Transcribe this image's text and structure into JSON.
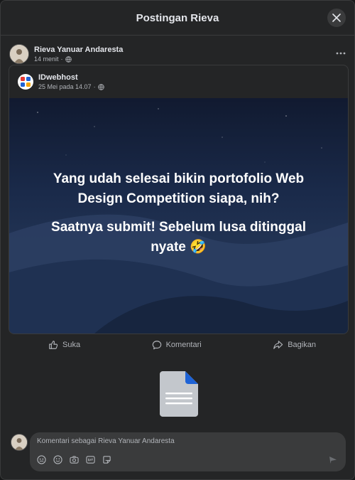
{
  "modal": {
    "title": "Postingan Rieva"
  },
  "post": {
    "author": "Rieva Yanuar Andaresta",
    "time": "14 menit",
    "separator": "·"
  },
  "shared": {
    "page_name": "IDwebhost",
    "date": "25 Mei pada 14.07",
    "separator": "·",
    "image_text_line1": "Yang udah selesai bikin portofolio Web Design Competition siapa, nih?",
    "image_text_line2": "Saatnya submit! Sebelum lusa ditinggal nyate 🤣"
  },
  "actions": {
    "like": "Suka",
    "comment": "Komentari",
    "share": "Bagikan"
  },
  "comment": {
    "placeholder": "Komentari sebagai Rieva Yanuar Andaresta"
  },
  "colors": {
    "background": "#242526",
    "text_primary": "#e4e6eb",
    "text_secondary": "#b0b3b8"
  },
  "icons": [
    "close-icon",
    "globe-icon",
    "more-icon",
    "like-icon",
    "comment-icon",
    "share-icon",
    "document-icon",
    "emoji-icon",
    "camera-icon",
    "gif-icon",
    "sticker-icon",
    "send-icon"
  ]
}
